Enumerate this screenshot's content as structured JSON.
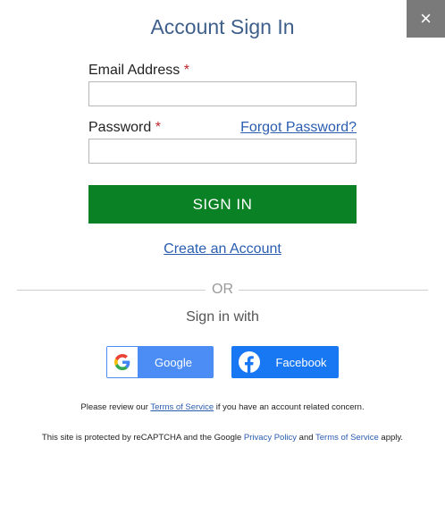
{
  "dialog": {
    "title": "Account Sign In",
    "close_glyph": "×"
  },
  "form": {
    "email_label": "Email Address",
    "email_value": "",
    "email_placeholder": "",
    "password_label": "Password",
    "password_value": "",
    "password_placeholder": "",
    "required_marker": "*",
    "forgot_link": "Forgot Password?",
    "submit_label": "SIGN IN",
    "create_account_link": "Create an Account"
  },
  "alt_sign_in": {
    "or_label": "OR",
    "heading": "Sign in with",
    "google_label": "Google",
    "facebook_label": "Facebook"
  },
  "footer": {
    "review_prefix": "Please review our ",
    "review_link": "Terms of Service",
    "review_suffix": " if you have an account related concern.",
    "recaptcha_prefix": "This site is protected by reCAPTCHA and the Google ",
    "privacy_link": "Privacy Policy",
    "recaptcha_and": " and ",
    "terms_link": "Terms of Service",
    "recaptcha_suffix": " apply."
  },
  "colors": {
    "title": "#3e5f8a",
    "primary_button": "#0a8124",
    "link": "#2a5db0",
    "required": "#c4262e",
    "google": "#4b8cf5",
    "facebook": "#1877f2",
    "close_bg": "#7a7a7a"
  },
  "icons": {
    "close": "close-icon",
    "google": "google-logo-icon",
    "facebook": "facebook-logo-icon"
  }
}
